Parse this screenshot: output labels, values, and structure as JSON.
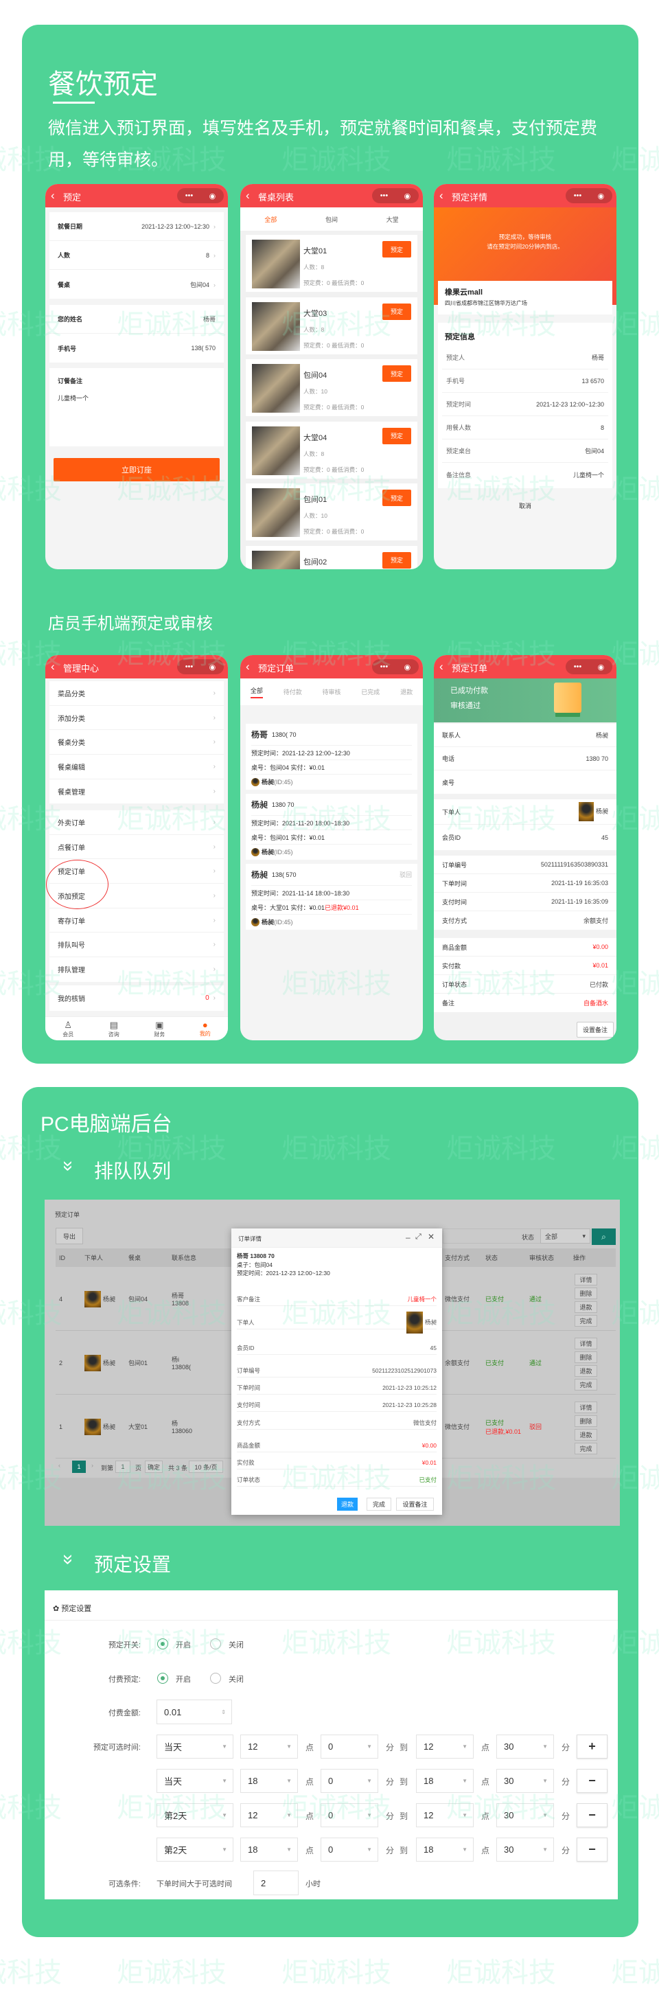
{
  "watermark": "炬诚科技",
  "colors": {
    "brand_green": "#4fd396",
    "header_red": "#f5474a",
    "accent_orange": "#ff5a0f",
    "pc_teal": "#117a6c",
    "primary_blue": "#1e9fff"
  },
  "section1": {
    "title": "餐饮预定",
    "description": "微信进入预订界面，填写姓名及手机，预定就餐时间和餐桌，支付预定费用，等待审核。",
    "booking": {
      "title": "预定",
      "groups": [
        [
          {
            "label": "就餐日期",
            "value": "2021-12-23 12:00~12:30",
            "arrow": "›"
          },
          {
            "label": "人数",
            "value": "8",
            "arrow": "›"
          },
          {
            "label": "餐桌",
            "value": "包间04",
            "arrow": "›"
          }
        ],
        [
          {
            "label": "您的姓名",
            "value": "杨哥",
            "arrow": ""
          },
          {
            "label": "手机号",
            "value": "138(    570",
            "arrow": ""
          }
        ]
      ],
      "note_label": "订餐备注",
      "note_value": "儿童椅一个",
      "submit": "立即订座"
    },
    "table_list": {
      "title": "餐桌列表",
      "tabs": [
        "全部",
        "包间",
        "大堂"
      ],
      "items": [
        {
          "name": "大堂01",
          "people": "人数：8",
          "fee": "预定费：0 最低消费：0",
          "button": "预定"
        },
        {
          "name": "大堂03",
          "people": "人数：8",
          "fee": "预定费：0 最低消费：0",
          "button": "预定"
        },
        {
          "name": "包间04",
          "people": "人数：10",
          "fee": "预定费：0 最低消费：0",
          "button": "预定"
        },
        {
          "name": "大堂04",
          "people": "人数：8",
          "fee": "预定费：0 最低消费：0",
          "button": "预定"
        },
        {
          "name": "包间01",
          "people": "人数：10",
          "fee": "预定费：0 最低消费：0",
          "button": "预定"
        },
        {
          "name": "包间02",
          "people": "",
          "fee": "",
          "button": "预定"
        }
      ]
    },
    "detail": {
      "title": "预定详情",
      "message1": "预定成功，等待审核",
      "message2": "请在预定时间20分钟内到店。",
      "store_name": "橡果云mall",
      "store_address": "四川省成都市锦江区锦华万达广场",
      "info_title": "预定信息",
      "rows": [
        {
          "label": "预定人",
          "value": "杨哥"
        },
        {
          "label": "手机号",
          "value": "13      6570"
        },
        {
          "label": "预定时间",
          "value": "2021-12-23 12:00~12:30"
        },
        {
          "label": "用餐人数",
          "value": "8"
        },
        {
          "label": "预定桌台",
          "value": "包间04"
        },
        {
          "label": "备注信息",
          "value": "儿童椅一个"
        }
      ],
      "cancel": "取消"
    }
  },
  "section2": {
    "title": "店员手机端预定或审核",
    "admin": {
      "title": "管理中心",
      "groups": [
        [
          "菜品分类",
          "添加分类",
          "餐桌分类",
          "餐桌编辑",
          "餐桌管理"
        ],
        [
          "外卖订单",
          "点餐订单",
          "预定订单",
          "添加预定",
          "寄存订单",
          "排队叫号",
          "排队管理"
        ]
      ],
      "my_verify": "我的核销",
      "my_verify_count": "0",
      "tabbar": [
        {
          "label": "会员",
          "icon": "user-icon"
        },
        {
          "label": "咨询",
          "icon": "message-icon"
        },
        {
          "label": "财务",
          "icon": "wallet-icon"
        },
        {
          "label": "我的",
          "icon": "profile-icon"
        }
      ]
    },
    "orders": {
      "title": "预定订单",
      "tabs": [
        "全部",
        "待付款",
        "待审核",
        "已完成",
        "退款"
      ],
      "items": [
        {
          "name": "杨哥",
          "phone": "1380(     70",
          "time": "预定时间：2021-12-23 12:00~12:30",
          "table": "桌号：包间04 实付：¥0.01",
          "refund": "",
          "status": "",
          "user": "杨昶",
          "user_id": "(ID:45)"
        },
        {
          "name": "杨昶",
          "phone": "1380      70",
          "time": "预定时间：2021-11-20 18:00~18:30",
          "table": "桌号：包间01 实付：¥0.01",
          "refund": "",
          "status": "",
          "user": "杨昶",
          "user_id": "(ID:45)"
        },
        {
          "name": "杨昶",
          "phone": "138(     570",
          "time": "预定时间：2021-11-14 18:00~18:30",
          "table": "桌号：大堂01 实付：¥0.01",
          "refund": "已退款¥0.01",
          "status": "驳回",
          "user": "杨昶",
          "user_id": "(ID:45)"
        }
      ]
    },
    "order_detail": {
      "title": "预定订单",
      "banner1": "已成功付款",
      "banner2": "审核通过",
      "groups": [
        [
          {
            "label": "联系人",
            "value": "杨昶"
          },
          {
            "label": "电话",
            "value": "1380      70"
          },
          {
            "label": "桌号",
            "value": ""
          }
        ],
        [
          {
            "label": "下单人",
            "value": "杨昶",
            "avatar": true
          },
          {
            "label": "会员ID",
            "value": "45"
          }
        ],
        [
          {
            "label": "订单编号",
            "value": "50211119163503890331"
          },
          {
            "label": "下单时间",
            "value": "2021-11-19 16:35:03"
          },
          {
            "label": "支付时间",
            "value": "2021-11-19 16:35:09"
          },
          {
            "label": "支付方式",
            "value": "余额支付"
          }
        ],
        [
          {
            "label": "商品金额",
            "value": "¥0.00",
            "red": true
          },
          {
            "label": "实付款",
            "value": "¥0.01",
            "red": true
          },
          {
            "label": "订单状态",
            "value": "已付款"
          },
          {
            "label": "备注",
            "value": "自备酒水",
            "red": true
          }
        ]
      ],
      "set_note": "设置备注"
    }
  },
  "section3": {
    "title": "PC电脑端后台",
    "sub1": "排队队列",
    "pc": {
      "page_title": "预定订单",
      "export": "导出",
      "status_label": "状态",
      "status_value": "全部",
      "columns": [
        "ID",
        "下单人",
        "餐桌",
        "联系信息",
        "支付方式",
        "状态",
        "审核状态",
        "操作"
      ],
      "rows": [
        {
          "id": "4",
          "user": "杨昶",
          "table": "包间04",
          "contact1": "杨哥",
          "contact2": "13808",
          "pay": "微信支付",
          "status": "已支付",
          "status2": "",
          "audit": "通过",
          "audit_red": false
        },
        {
          "id": "2",
          "user": "杨昶",
          "table": "包间01",
          "contact1": "杨i",
          "contact2": "13808(",
          "pay": "余额支付",
          "status": "已支付",
          "status2": "",
          "audit": "通过",
          "audit_red": false
        },
        {
          "id": "1",
          "user": "杨昶",
          "table": "大堂01",
          "contact1": "杨",
          "contact2": "138060",
          "pay": "微信支付",
          "status": "已支付",
          "status2": "已退款,¥0.01",
          "audit": "驳回",
          "audit_red": true
        }
      ],
      "ops": [
        "详情",
        "删除",
        "退款",
        "完成"
      ],
      "pager": {
        "current": "1",
        "goto": "到第",
        "page_input": "1",
        "page_unit": "页",
        "confirm": "确定",
        "total": "共 3 条",
        "per_page": "10 条/页"
      },
      "modal": {
        "title": "订单详情",
        "line1": "杨哥 13808     70",
        "line2": "桌子：包间04",
        "line3": "预定时间：2021-12-23 12:00~12:30",
        "rows": [
          {
            "label": "客户备注",
            "value": "儿童椅一个",
            "cls": "red"
          },
          {
            "label": "下单人",
            "value": "杨昶",
            "cls": "avatar"
          },
          {
            "label": "会员ID",
            "value": "45",
            "cls": ""
          },
          {
            "label": "订单编号",
            "value": "50211223102512901073",
            "cls": ""
          },
          {
            "label": "下单时间",
            "value": "2021-12-23 10:25:12",
            "cls": ""
          },
          {
            "label": "支付时间",
            "value": "2021-12-23 10:25:28",
            "cls": ""
          },
          {
            "label": "支付方式",
            "value": "微信支付",
            "cls": ""
          },
          {
            "label": "商品金额",
            "value": "¥0.00",
            "cls": "red"
          },
          {
            "label": "实付款",
            "value": "¥0.01",
            "cls": "red"
          },
          {
            "label": "订单状态",
            "value": "已支付",
            "cls": "green"
          }
        ],
        "buttons": [
          "退款",
          "完成",
          "设置备注"
        ]
      }
    },
    "sub2": "预定设置",
    "settings": {
      "title": "预定设置",
      "switch_label": "预定开关:",
      "paid_label": "付费预定:",
      "on": "开启",
      "off": "关闭",
      "switch_on": true,
      "paid_on": true,
      "amount_label": "付费金额:",
      "amount": "0.01",
      "time_label": "预定可选时间:",
      "unit_hour": "点",
      "unit_min": "分",
      "to": "到",
      "times": [
        {
          "day": "当天",
          "h1": "12",
          "m1": "0",
          "h2": "12",
          "m2": "30",
          "btn": "+"
        },
        {
          "day": "当天",
          "h1": "18",
          "m1": "0",
          "h2": "18",
          "m2": "30",
          "btn": "−"
        },
        {
          "day": "第2天",
          "h1": "12",
          "m1": "0",
          "h2": "12",
          "m2": "30",
          "btn": "−"
        },
        {
          "day": "第2天",
          "h1": "18",
          "m1": "0",
          "h2": "18",
          "m2": "30",
          "btn": "−"
        }
      ],
      "cond_label": "可选条件:",
      "cond_text": "下单时间大于可选时间",
      "cond_hours": "2",
      "cond_unit": "小时"
    }
  }
}
